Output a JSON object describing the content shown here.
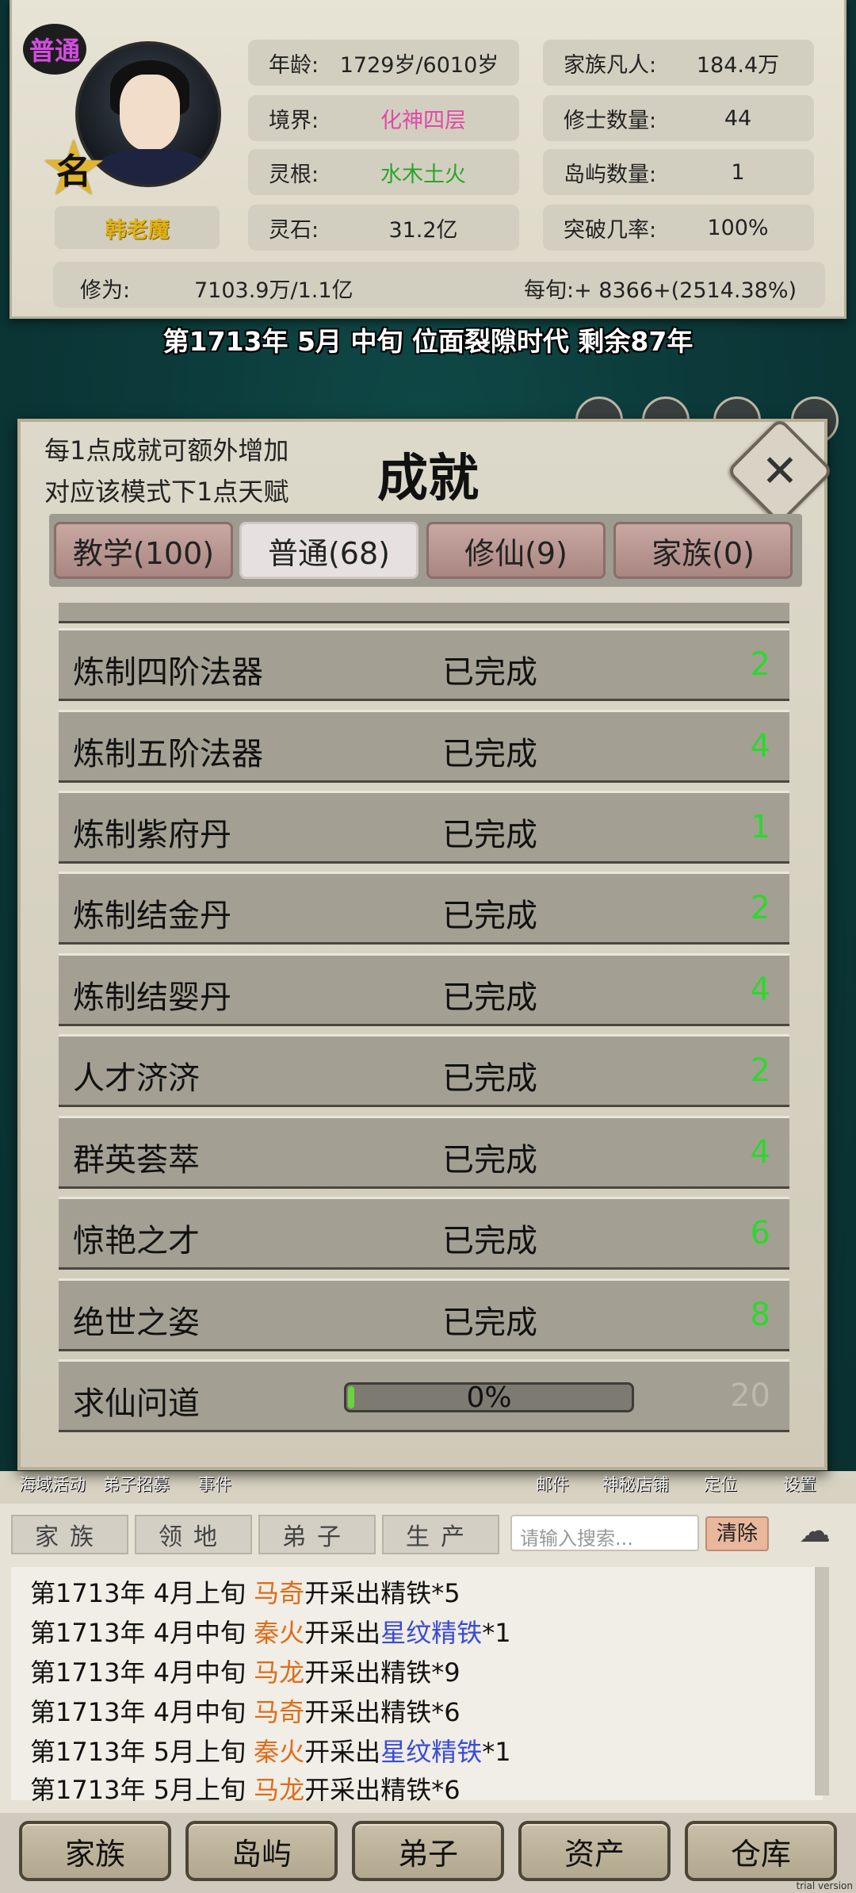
{
  "player": {
    "mode_badge": "普通",
    "name": "韩老魔",
    "rank_glyph": "名"
  },
  "stats": {
    "age_label": "年龄:",
    "age_value": "1729岁/6010岁",
    "realm_label": "境界:",
    "realm_value": "化神四层",
    "root_label": "灵根:",
    "root_value": "水木土火",
    "stone_label": "灵石:",
    "stone_value": "31.2亿",
    "family_label": "家族凡人:",
    "family_value": "184.4万",
    "cultivators_label": "修士数量:",
    "cultivators_value": "44",
    "islands_label": "岛屿数量:",
    "islands_value": "1",
    "breakthrough_label": "突破几率:",
    "breakthrough_value": "100%",
    "cultivation_label": "修为:",
    "cultivation_value": "7103.9万/1.1亿",
    "per_period": "每旬:+ 8366+(2514.38%)"
  },
  "era": "第1713年 5月 中旬  位面裂隙时代 剩余87年",
  "dialog": {
    "note_line1": "每1点成就可额外增加",
    "note_line2": "对应该模式下1点天赋",
    "title": "成就",
    "close_label": "✕",
    "tabs": [
      {
        "label": "教学(100)"
      },
      {
        "label": "普通(68)"
      },
      {
        "label": "修仙(9)"
      },
      {
        "label": "家族(0)"
      }
    ],
    "achievements": [
      {
        "name": "炼制四阶法器",
        "status": "已完成",
        "points": "2"
      },
      {
        "name": "炼制五阶法器",
        "status": "已完成",
        "points": "4"
      },
      {
        "name": "炼制紫府丹",
        "status": "已完成",
        "points": "1"
      },
      {
        "name": "炼制结金丹",
        "status": "已完成",
        "points": "2"
      },
      {
        "name": "炼制结婴丹",
        "status": "已完成",
        "points": "4"
      },
      {
        "name": "人才济济",
        "status": "已完成",
        "points": "2"
      },
      {
        "name": "群英荟萃",
        "status": "已完成",
        "points": "4"
      },
      {
        "name": "惊艳之才",
        "status": "已完成",
        "points": "6"
      },
      {
        "name": "绝世之姿",
        "status": "已完成",
        "points": "8"
      }
    ],
    "in_progress": {
      "name": "求仙问道",
      "progress_text": "0%",
      "progress_fraction": 0.0,
      "points": "20"
    }
  },
  "shortcuts": [
    "海域活动",
    "弟子招募",
    "事件",
    "邮件",
    "神秘店铺",
    "定位",
    "设置"
  ],
  "log": {
    "tabs": [
      "家族",
      "领地",
      "弟子",
      "生产"
    ],
    "search_placeholder": "请输入搜索...",
    "clear_label": "清除",
    "entries": [
      {
        "time": "第1713年 4月上旬 ",
        "who": "马奇",
        "action": "开采出",
        "item": "",
        "rest": "精铁*5"
      },
      {
        "time": "第1713年 4月中旬 ",
        "who": "秦火",
        "action": "开采出",
        "item": "星纹精铁",
        "rest": "*1"
      },
      {
        "time": "第1713年 4月中旬 ",
        "who": "马龙",
        "action": "开采出",
        "item": "",
        "rest": "精铁*9"
      },
      {
        "time": "第1713年 4月中旬 ",
        "who": "马奇",
        "action": "开采出",
        "item": "",
        "rest": "精铁*6"
      },
      {
        "time": "第1713年 5月上旬 ",
        "who": "秦火",
        "action": "开采出",
        "item": "星纹精铁",
        "rest": "*1"
      },
      {
        "time": "第1713年 5月上旬 ",
        "who": "马龙",
        "action": "开采出",
        "item": "",
        "rest": "精铁*6"
      }
    ]
  },
  "nav": [
    "家族",
    "岛屿",
    "弟子",
    "资产",
    "仓库"
  ],
  "watermark": "trial version"
}
